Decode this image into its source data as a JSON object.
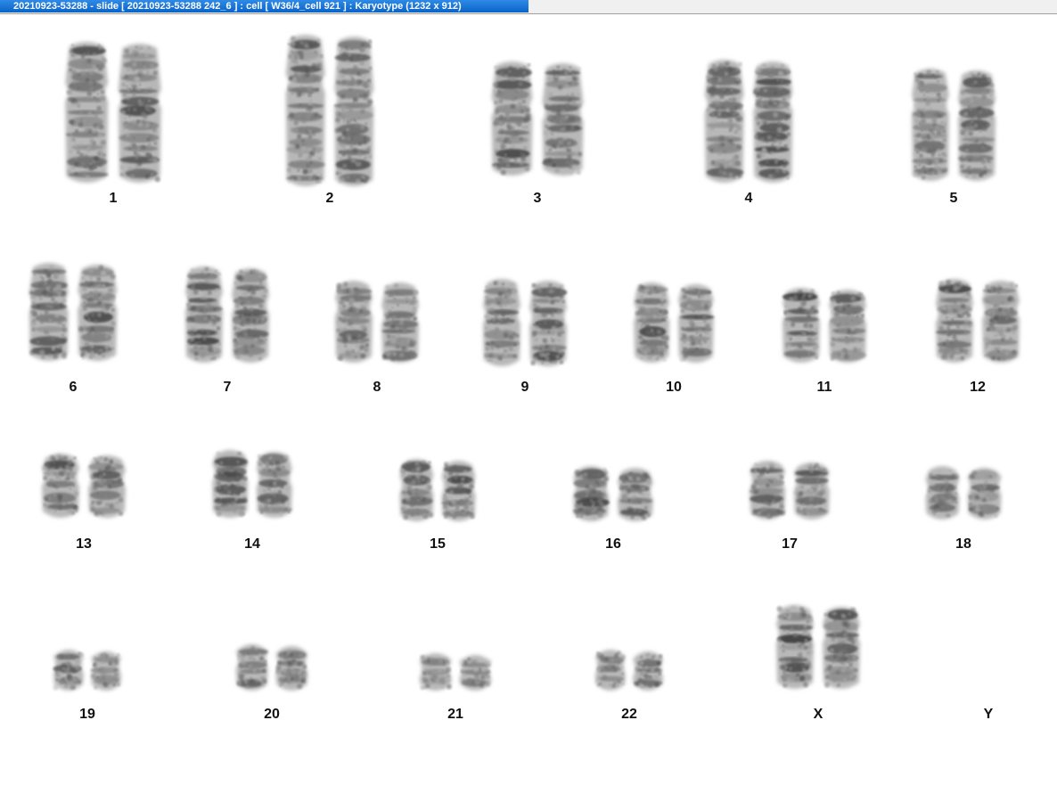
{
  "window": {
    "title": "20210923-53288 - slide [ 20210923-53288 242_6 ] : cell [ W36/4_cell 921 ] : Karyotype  (1232 x 912)"
  },
  "karyotype": {
    "labels": [
      "1",
      "2",
      "3",
      "4",
      "5",
      "6",
      "7",
      "8",
      "9",
      "10",
      "11",
      "12",
      "13",
      "14",
      "15",
      "16",
      "17",
      "18",
      "19",
      "20",
      "21",
      "22",
      "X",
      "Y"
    ]
  },
  "colors": {
    "background": "#ffffff",
    "titlebar": "#0a64c8",
    "chromosome_dark": "#3a3a3a",
    "chromosome_light": "#b8b8b8"
  }
}
